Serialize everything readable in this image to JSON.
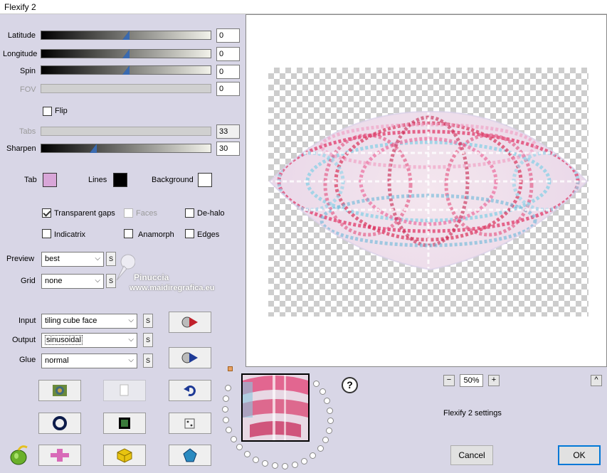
{
  "window": {
    "title": "Flexify 2"
  },
  "sliders": [
    {
      "label": "Latitude",
      "value": "0",
      "disabled": false,
      "position": 0.5
    },
    {
      "label": "Longitude",
      "value": "0",
      "disabled": false,
      "position": 0.5
    },
    {
      "label": "Spin",
      "value": "0",
      "disabled": false,
      "position": 0.5
    },
    {
      "label": "FOV",
      "value": "0",
      "disabled": true
    },
    {
      "label": "Tabs",
      "value": "33",
      "disabled": true
    },
    {
      "label": "Sharpen",
      "value": "30",
      "disabled": false,
      "position": 0.3
    }
  ],
  "flip": {
    "label": "Flip",
    "checked": false
  },
  "colors": {
    "tab": {
      "label": "Tab",
      "color": "#d8a6d8"
    },
    "lines": {
      "label": "Lines",
      "color": "#000000"
    },
    "background": {
      "label": "Background",
      "color": "#ffffff"
    }
  },
  "options": {
    "transparent_gaps": {
      "label": "Transparent gaps",
      "checked": true
    },
    "faces": {
      "label": "Faces",
      "checked": false,
      "disabled": true
    },
    "de_halo": {
      "label": "De-halo",
      "checked": false
    },
    "indicatrix": {
      "label": "Indicatrix",
      "checked": false
    },
    "anamorph": {
      "label": "Anamorph",
      "checked": false
    },
    "edges": {
      "label": "Edges",
      "checked": false
    }
  },
  "preview_select": {
    "label": "Preview",
    "value": "best"
  },
  "grid_select": {
    "label": "Grid",
    "value": "none"
  },
  "input_select": {
    "label": "Input",
    "value": "tiling cube face"
  },
  "output_select": {
    "label": "Output",
    "value": "sinusoidal"
  },
  "glue_select": {
    "label": "Glue",
    "value": "normal"
  },
  "s_label": "S",
  "watermark": {
    "name": "Pinuccia",
    "url": "www.maidiregrafica.eu"
  },
  "zoom": {
    "minus": "−",
    "value": "50%",
    "plus": "+"
  },
  "collapse_label": "^",
  "help_label": "?",
  "settings_label": "Flexify 2 settings",
  "buttons": {
    "cancel": "Cancel",
    "ok": "OK"
  },
  "accent": "#0078d7"
}
